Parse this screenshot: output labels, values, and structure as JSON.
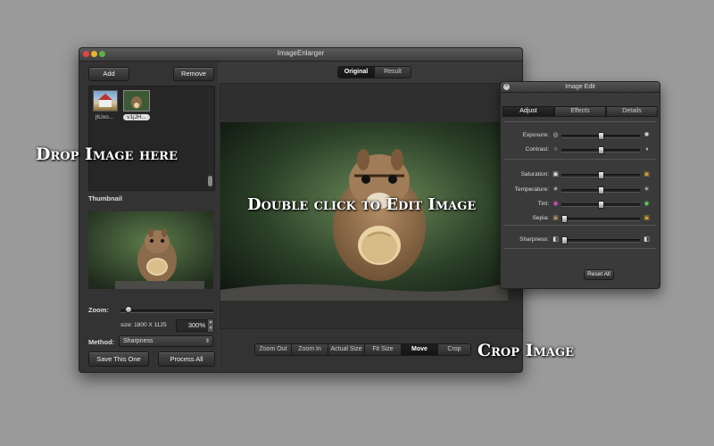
{
  "window": {
    "title": "ImageEnlarger"
  },
  "left": {
    "add_label": "Add",
    "remove_label": "Remove",
    "thumbs": [
      {
        "caption": "jtUxo..."
      },
      {
        "caption": "v1jJH..."
      }
    ],
    "thumbnail_label": "Thumbnail",
    "zoom_label": "Zoom:",
    "size_text": "size: 1800 X 1125",
    "zoom_value": "300%",
    "zoom_level": 0.05,
    "method_label": "Method:",
    "method_value": "Sharpness",
    "save_label": "Save This One",
    "process_label": "Process All"
  },
  "view_tabs": {
    "original": "Original",
    "result": "Result",
    "selected": "Original"
  },
  "toolbar": {
    "zoom_out": "Zoom Out",
    "zoom_in": "Zoom In",
    "actual_size": "Actual Size",
    "fit_size": "Fit Size",
    "move": "Move",
    "crop": "Crop",
    "selected": "Move"
  },
  "image_edit": {
    "title": "Image Edit",
    "tabs": [
      "Adjust",
      "Effects",
      "Details"
    ],
    "selected_tab": "Adjust",
    "sliders": [
      {
        "label": "Exposure:",
        "level": 0.5
      },
      {
        "label": "Contrast:",
        "level": 0.5
      },
      {
        "label": "Saturation:",
        "level": 0.5
      },
      {
        "label": "Temperature:",
        "level": 0.5
      },
      {
        "label": "Tint:",
        "level": 0.5
      },
      {
        "label": "Sepia:",
        "level": 0.0
      },
      {
        "label": "Sharpness:",
        "level": 0.0
      }
    ],
    "reset_label": "Reset All"
  },
  "overlays": {
    "drop": "Drop Image here",
    "double_click": "Double click to Edit Image",
    "crop": "Crop Image"
  },
  "colors": {
    "background": "#9a9a9a",
    "window": "#3a3a3a",
    "selected_segment": "#141414"
  }
}
